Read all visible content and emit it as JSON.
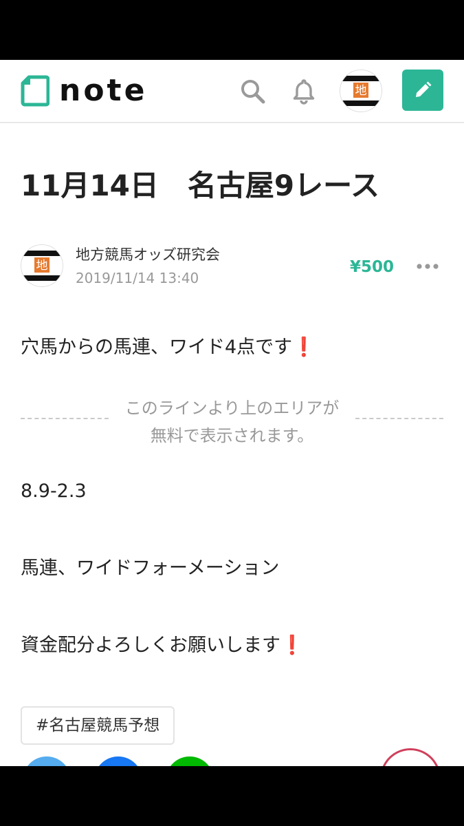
{
  "header": {
    "logo_text": "note",
    "avatar_glyph": "地",
    "icons": [
      "note-logo-icon",
      "search-icon",
      "bell-icon",
      "pencil-icon"
    ],
    "accent_color": "#2cb696"
  },
  "article": {
    "title": "11月14日　名古屋9レース",
    "author_name": "地方競馬オッズ研究会",
    "date": "2019/11/14 13:40",
    "price": "¥500",
    "intro": "穴馬からの馬連、ワイド4点です",
    "excl": "❗",
    "paywall_line1": "このラインより上のエリアが",
    "paywall_line2": "無料で表示されます。",
    "line_1": "8.9-2.3",
    "line_2": "馬連、ワイドフォーメーション",
    "line_3": "資金配分よろしくお願いします",
    "tag": "#名古屋競馬予想"
  },
  "share": {
    "icons": [
      "twitter-share-icon",
      "facebook-share-icon",
      "line-share-icon",
      "like-icon"
    ]
  }
}
